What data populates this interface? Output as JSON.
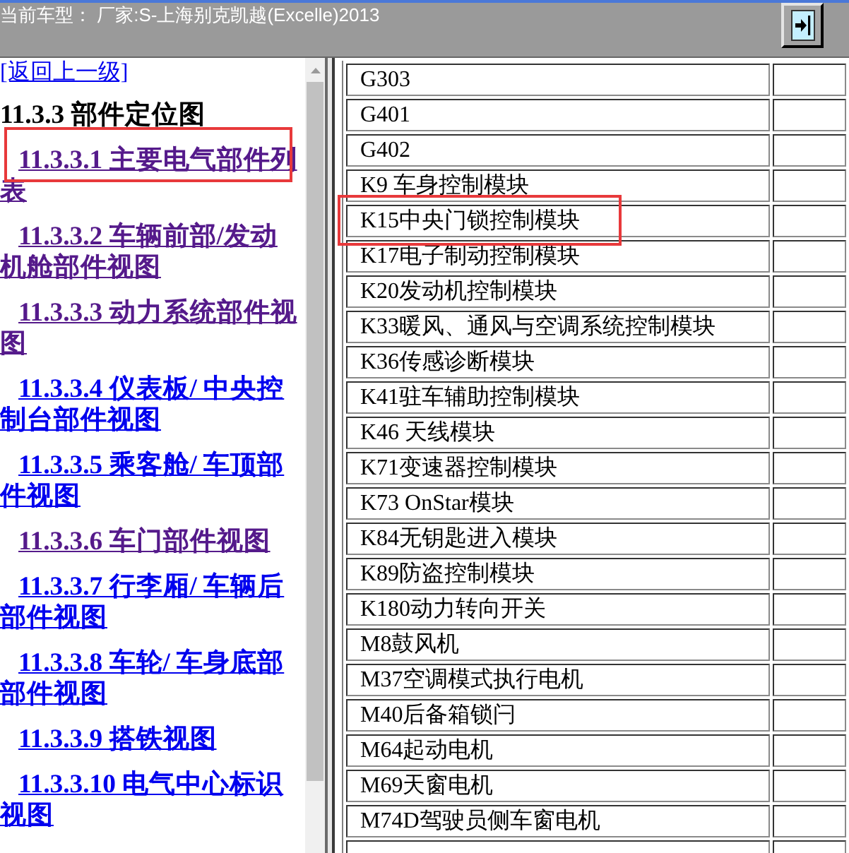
{
  "top_bar": {
    "title": "当前车型： 厂家:S-上海别克凯越(Excelle)2013"
  },
  "left_pane": {
    "back_link": "[返回上一级]",
    "heading": "11.3.3 部件定位图",
    "links": [
      {
        "label": "11.3.3.1 主要电气部件列表",
        "visited": true,
        "highlighted": true
      },
      {
        "label": "11.3.3.2 车辆前部/发动机舱部件视图",
        "visited": true,
        "highlighted": false
      },
      {
        "label": "11.3.3.3 动力系统部件视图",
        "visited": true,
        "highlighted": false
      },
      {
        "label": "11.3.3.4 仪表板/ 中央控制台部件视图",
        "visited": false,
        "highlighted": false
      },
      {
        "label": "11.3.3.5 乘客舱/ 车顶部件视图",
        "visited": false,
        "highlighted": false
      },
      {
        "label": "11.3.3.6 车门部件视图",
        "visited": true,
        "highlighted": false
      },
      {
        "label": "11.3.3.7 行李厢/ 车辆后部件视图",
        "visited": false,
        "highlighted": false
      },
      {
        "label": "11.3.3.8 车轮/ 车身底部部件视图",
        "visited": false,
        "highlighted": false
      },
      {
        "label": "11.3.3.9 搭铁视图",
        "visited": false,
        "highlighted": false
      },
      {
        "label": "11.3.3.10 电气中心标识视图",
        "visited": false,
        "highlighted": false
      }
    ]
  },
  "table": {
    "rows": [
      {
        "column_1": "G303",
        "highlighted": false
      },
      {
        "column_1": "G401",
        "highlighted": false
      },
      {
        "column_1": "G402",
        "highlighted": false
      },
      {
        "column_1": "K9 车身控制模块",
        "highlighted": false
      },
      {
        "column_1": "K15中央门锁控制模块",
        "highlighted": true
      },
      {
        "column_1": "K17电子制动控制模块",
        "highlighted": false
      },
      {
        "column_1": "K20发动机控制模块",
        "highlighted": false
      },
      {
        "column_1": "K33暖风、通风与空调系统控制模块",
        "highlighted": false
      },
      {
        "column_1": "K36传感诊断模块",
        "highlighted": false
      },
      {
        "column_1": "K41驻车辅助控制模块",
        "highlighted": false
      },
      {
        "column_1": "K46 天线模块",
        "highlighted": false
      },
      {
        "column_1": "K71变速器控制模块",
        "highlighted": false
      },
      {
        "column_1": "K73 OnStar模块",
        "highlighted": false
      },
      {
        "column_1": "K84无钥匙进入模块",
        "highlighted": false
      },
      {
        "column_1": "K89防盗控制模块",
        "highlighted": false
      },
      {
        "column_1": "K180动力转向开关",
        "highlighted": false
      },
      {
        "column_1": "M8鼓风机",
        "highlighted": false
      },
      {
        "column_1": "M37空调模式执行电机",
        "highlighted": false
      },
      {
        "column_1": "M40后备箱锁闩",
        "highlighted": false
      },
      {
        "column_1": "M64起动电机",
        "highlighted": false
      },
      {
        "column_1": "M69天窗电机",
        "highlighted": false
      },
      {
        "column_1": "M74D驾驶员侧车窗电机",
        "highlighted": false
      },
      {
        "highlighted": false
      }
    ]
  }
}
